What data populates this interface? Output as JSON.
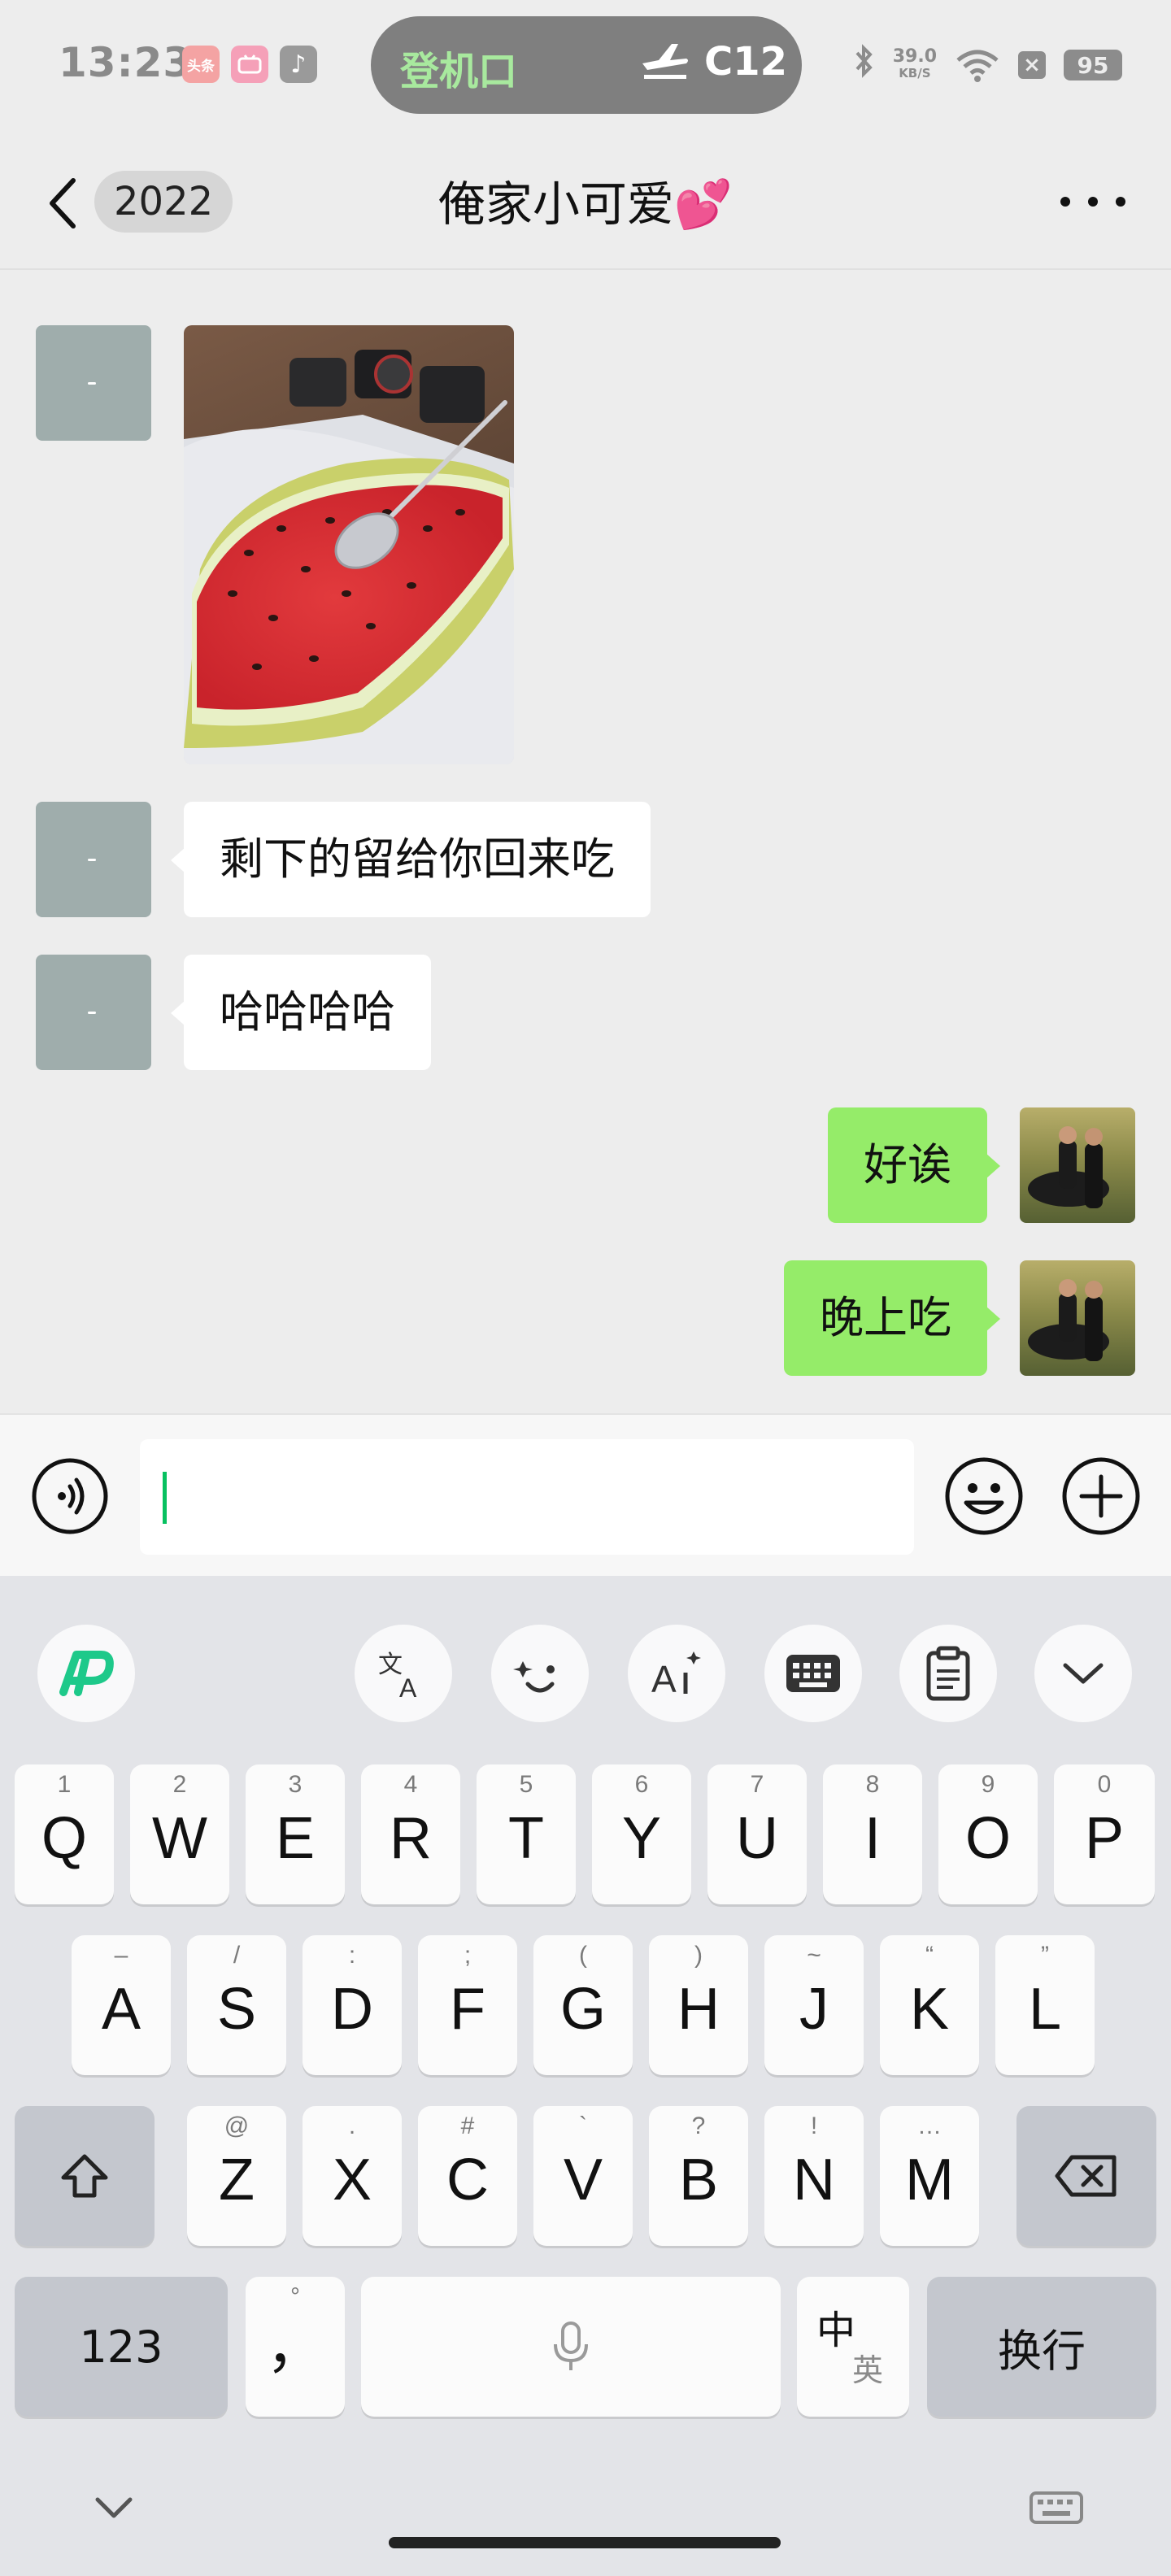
{
  "status_bar": {
    "time": "13:23",
    "app_icons": [
      "头条",
      "bilibili",
      "♪"
    ],
    "live_activity": {
      "label": "登机口",
      "gate": "C12"
    },
    "network_speed": "39.0",
    "network_unit": "KB/S",
    "battery": "95"
  },
  "header": {
    "unread_count": "2022",
    "title": "俺家小可爱💕"
  },
  "messages": [
    {
      "side": "in",
      "type": "image",
      "description": "watermelon-photo"
    },
    {
      "side": "in",
      "type": "text",
      "text": "剩下的留给你回来吃"
    },
    {
      "side": "in",
      "type": "text",
      "text": "哈哈哈哈"
    },
    {
      "side": "out",
      "type": "text",
      "text": "好诶"
    },
    {
      "side": "out",
      "type": "text",
      "text": "晚上吃"
    }
  ],
  "input": {
    "value": ""
  },
  "keyboard": {
    "row1": [
      {
        "main": "Q",
        "sub": "1"
      },
      {
        "main": "W",
        "sub": "2"
      },
      {
        "main": "E",
        "sub": "3"
      },
      {
        "main": "R",
        "sub": "4"
      },
      {
        "main": "T",
        "sub": "5"
      },
      {
        "main": "Y",
        "sub": "6"
      },
      {
        "main": "U",
        "sub": "7"
      },
      {
        "main": "I",
        "sub": "8"
      },
      {
        "main": "O",
        "sub": "9"
      },
      {
        "main": "P",
        "sub": "0"
      }
    ],
    "row2": [
      {
        "main": "A",
        "sub": "–"
      },
      {
        "main": "S",
        "sub": "/"
      },
      {
        "main": "D",
        "sub": ":"
      },
      {
        "main": "F",
        "sub": ";"
      },
      {
        "main": "G",
        "sub": "("
      },
      {
        "main": "H",
        "sub": ")"
      },
      {
        "main": "J",
        "sub": "~"
      },
      {
        "main": "K",
        "sub": "“"
      },
      {
        "main": "L",
        "sub": "”"
      }
    ],
    "row3": [
      {
        "main": "Z",
        "sub": "@"
      },
      {
        "main": "X",
        "sub": "."
      },
      {
        "main": "C",
        "sub": "#"
      },
      {
        "main": "V",
        "sub": "`"
      },
      {
        "main": "B",
        "sub": "?"
      },
      {
        "main": "N",
        "sub": "!"
      },
      {
        "main": "M",
        "sub": "…"
      }
    ],
    "numbers_label": "123",
    "comma_main": "，",
    "comma_sub": "°",
    "lang_top": "中",
    "lang_bottom": "英",
    "enter_label": "换行"
  }
}
